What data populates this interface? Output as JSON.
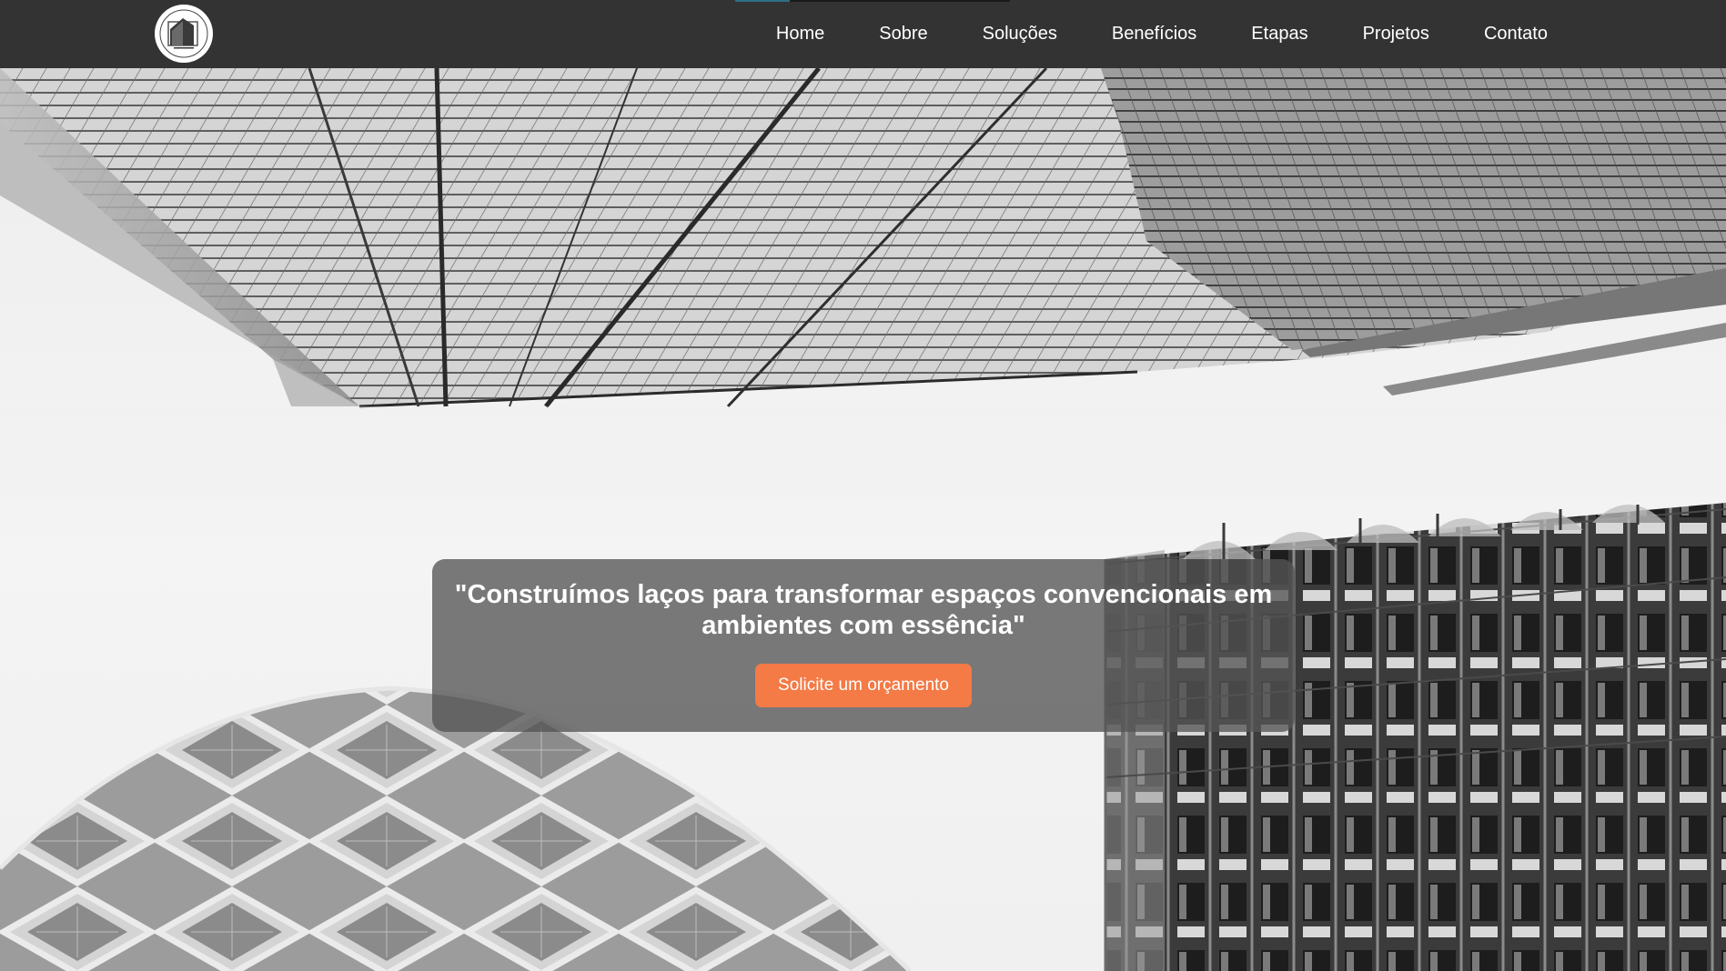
{
  "nav": {
    "logo_icon": "house-logo-icon",
    "scroll_progress": 0.2,
    "links": [
      {
        "label": "Home"
      },
      {
        "label": "Sobre"
      },
      {
        "label": "Soluções"
      },
      {
        "label": "Benefícios"
      },
      {
        "label": "Etapas"
      },
      {
        "label": "Projetos"
      },
      {
        "label": "Contato"
      }
    ]
  },
  "hero": {
    "title": "\"Construímos laços para transformar espaços convencionais em ambientes com essência\"",
    "cta_label": "Solicite um orçamento"
  },
  "colors": {
    "navbar": "#333333",
    "cta": "#f47a46",
    "progress": "#2f6e86"
  }
}
